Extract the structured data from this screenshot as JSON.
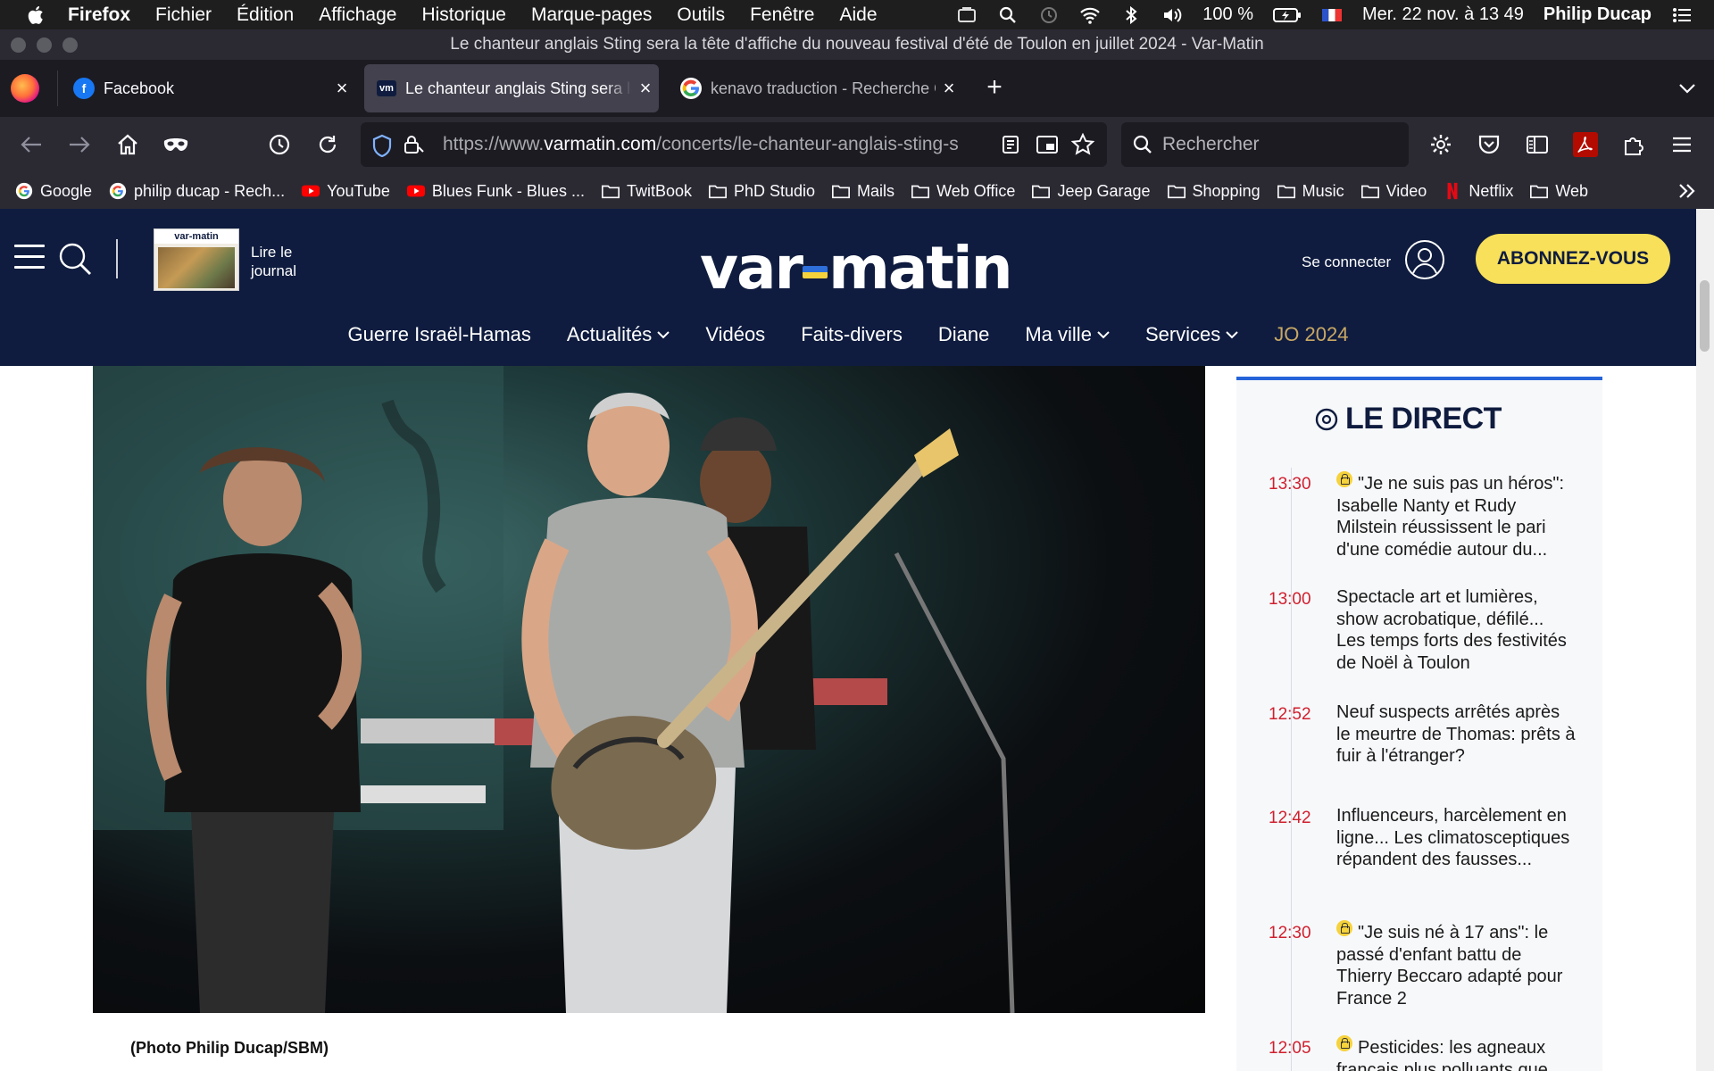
{
  "menubar": {
    "app_name": "Firefox",
    "items": [
      "Fichier",
      "Édition",
      "Affichage",
      "Historique",
      "Marque-pages",
      "Outils",
      "Fenêtre",
      "Aide"
    ],
    "battery": "100 %",
    "datetime": "Mer. 22 nov. à 13 49",
    "user": "Philip Ducap"
  },
  "window": {
    "title": "Le chanteur anglais Sting sera la tête d'affiche du nouveau festival d'été de Toulon en juillet 2024 - Var-Matin"
  },
  "tabs": [
    {
      "label": "Facebook",
      "favicon": "facebook-icon",
      "active": false
    },
    {
      "label": "Le chanteur anglais Sting sera la tête d'affiche",
      "favicon": "varmatin-icon",
      "favicon_text": "vm",
      "active": true
    },
    {
      "label": "kenavo traduction - Recherche Google",
      "favicon": "google-icon",
      "active": false
    }
  ],
  "urlbar": {
    "url_prefix": "https://www.",
    "url_domain": "varmatin.com",
    "url_path": "/concerts/le-chanteur-anglais-sting-s"
  },
  "searchbar": {
    "placeholder": "Rechercher"
  },
  "bookmarks": [
    {
      "label": "Google",
      "icon": "google-icon"
    },
    {
      "label": "philip ducap - Rech...",
      "icon": "google-icon"
    },
    {
      "label": "YouTube",
      "icon": "youtube-icon"
    },
    {
      "label": "Blues Funk - Blues ...",
      "icon": "youtube-icon"
    },
    {
      "label": "TwitBook",
      "icon": "folder-icon"
    },
    {
      "label": "PhD Studio",
      "icon": "folder-icon"
    },
    {
      "label": "Mails",
      "icon": "folder-icon"
    },
    {
      "label": "Web Office",
      "icon": "folder-icon"
    },
    {
      "label": "Jeep Garage",
      "icon": "folder-icon"
    },
    {
      "label": "Shopping",
      "icon": "folder-icon"
    },
    {
      "label": "Music",
      "icon": "folder-icon"
    },
    {
      "label": "Video",
      "icon": "folder-icon"
    },
    {
      "label": "Netflix",
      "icon": "netflix-icon"
    },
    {
      "label": "Web",
      "icon": "folder-icon"
    }
  ],
  "site": {
    "journal_thumb_title": "var-matin",
    "read_journal": "Lire le journal",
    "logo_left": "var",
    "logo_right": "matin",
    "login": "Se connecter",
    "subscribe": "ABONNEZ-VOUS",
    "nav": [
      {
        "label": "Guerre Israël-Hamas",
        "dropdown": false
      },
      {
        "label": "Actualités",
        "dropdown": true
      },
      {
        "label": "Vidéos",
        "dropdown": false
      },
      {
        "label": "Faits-divers",
        "dropdown": false
      },
      {
        "label": "Diane",
        "dropdown": false
      },
      {
        "label": "Ma ville",
        "dropdown": true
      },
      {
        "label": "Services",
        "dropdown": true
      },
      {
        "label": "JO 2024",
        "dropdown": false
      }
    ]
  },
  "article": {
    "photo_alt": "Sting playing bass guitar on stage with musicians",
    "caption": "(Photo Philip Ducap/SBM)"
  },
  "direct": {
    "title": "LE DIRECT",
    "items": [
      {
        "time": "13:30",
        "locked": true,
        "text": "\"Je ne suis pas un héros\": Isabelle Nanty et Rudy Milstein réussissent le pari d'une comédie autour du..."
      },
      {
        "time": "13:00",
        "locked": false,
        "text": "Spectacle art et lumières, show acrobatique, défilé... Les temps forts des festivités de Noël à Toulon"
      },
      {
        "time": "12:52",
        "locked": false,
        "text": "Neuf suspects arrêtés après le meurtre de Thomas: prêts à fuir à l'étranger?"
      },
      {
        "time": "12:42",
        "locked": false,
        "text": "Influenceurs, harcèlement en ligne... Les climatosceptiques répandent des fausses..."
      },
      {
        "time": "12:30",
        "locked": true,
        "text": "\"Je suis né à 17 ans\": le passé d'enfant battu de Thierry Beccaro adapté pour France 2"
      },
      {
        "time": "12:05",
        "locked": true,
        "text": "Pesticides: les agneaux français plus polluants que"
      }
    ]
  },
  "colors": {
    "site_navy": "#0f1c3f",
    "subscribe_yellow": "#f8e05a",
    "time_red": "#d01f2e",
    "direct_accent": "#2563d9",
    "jo_gold": "#c9a865"
  }
}
